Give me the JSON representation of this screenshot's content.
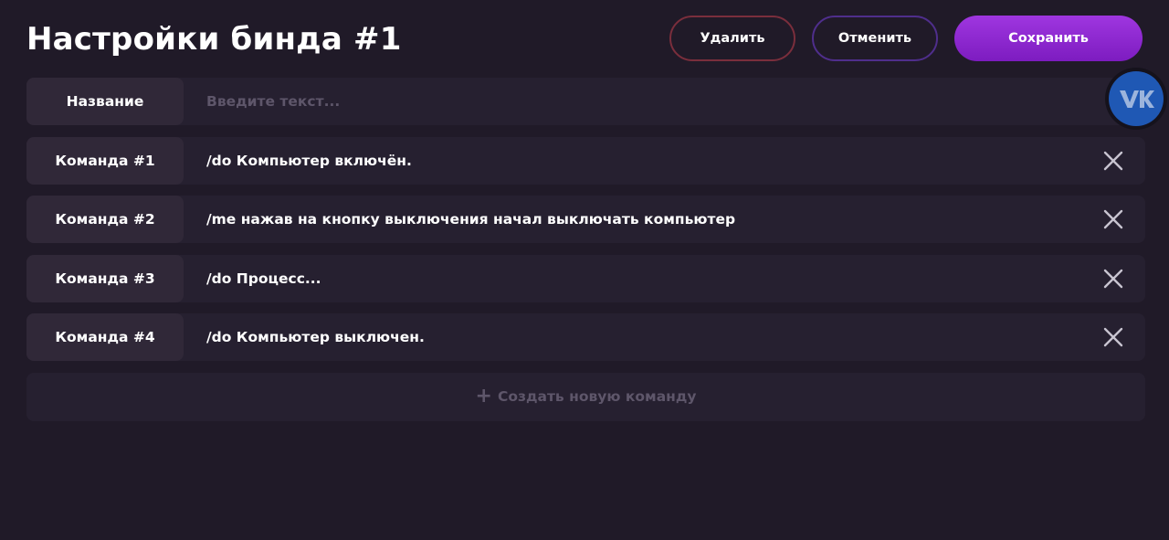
{
  "header": {
    "title": "Настройки бинда #1",
    "delete_label": "Удалить",
    "cancel_label": "Отменить",
    "save_label": "Сохранить"
  },
  "name_row": {
    "label": "Название",
    "value": "",
    "placeholder": "Введите текст..."
  },
  "commands": [
    {
      "label": "Команда #1",
      "value": "/do Компьютер включён."
    },
    {
      "label": "Команда #2",
      "value": "/me нажав на кнопку выключения начал выключать компьютер"
    },
    {
      "label": "Команда #3",
      "value": "/do Процесс..."
    },
    {
      "label": "Команда #4",
      "value": "/do Компьютер выключен."
    }
  ],
  "add_command": {
    "icon": "plus-icon",
    "label": "Создать новую команду"
  },
  "vk_badge": {
    "icon": "vk-logo-icon",
    "logo_text": "VK",
    "color": "#1f58b4"
  },
  "colors": {
    "background": "#201a28",
    "row": "#262030",
    "label_cell": "#302838",
    "save_accent": "#9f36e0",
    "delete_border": "#7a2e3c",
    "cancel_border": "#4f2e8c"
  }
}
